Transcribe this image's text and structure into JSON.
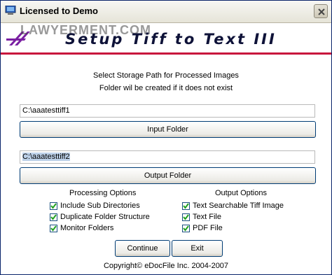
{
  "window": {
    "title": "Licensed to Demo"
  },
  "banner": {
    "watermark": "LAWYERMENT.COM",
    "title": "Setup Tiff to Text III"
  },
  "instructions": {
    "line1": "Select Storage Path for Processed Images",
    "line2": "Folder wil be created if it does not exist"
  },
  "input": {
    "value": "C:\\aaatesttiff1",
    "button_label": "Input Folder"
  },
  "output": {
    "value": "C:\\aaatesttiff2",
    "button_label": "Output Folder"
  },
  "processing_options": {
    "heading": "Processing Options",
    "items": [
      {
        "label": "Include Sub Directories",
        "checked": true
      },
      {
        "label": "Duplicate Folder Structure",
        "checked": true
      },
      {
        "label": "Monitor Folders",
        "checked": true
      }
    ]
  },
  "output_options": {
    "heading": "Output Options",
    "items": [
      {
        "label": "Text Searchable Tiff Image",
        "checked": true
      },
      {
        "label": "Text File",
        "checked": true
      },
      {
        "label": "PDF File",
        "checked": true
      }
    ]
  },
  "actions": {
    "continue_label": "Continue",
    "exit_label": "Exit"
  },
  "footer": {
    "copyright": "Copyright© eDocFile Inc. 2004-2007"
  },
  "colors": {
    "banner_line": "#c8143c",
    "logo_purple": "#7a1fa2",
    "check_green": "#21a121"
  }
}
